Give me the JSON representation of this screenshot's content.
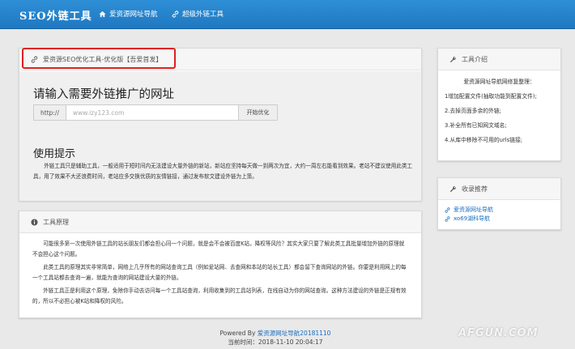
{
  "header": {
    "brand": "SEO外链工具",
    "nav": [
      {
        "label": "爱资源网址导航",
        "icon": "home-icon"
      },
      {
        "label": "超级外链工具",
        "icon": "link-icon"
      }
    ]
  },
  "main": {
    "panel_title": "爱资源SEO优化工具-优化版【吾爱首发】",
    "heading": "请输入需要外链推广的网址",
    "input_addon": "http://",
    "input_placeholder": "www.izy123.com",
    "submit_label": "开始优化",
    "tips_heading": "使用提示",
    "tips_text": "外链工具只是辅助工具，一般适用于短时间内无法建设大量外链的新站，新站应坚持每天做一到两次为宜，大约一周左右能看到效果。老站不建议使用此类工具，用了效果不大还浪费时间，老站应多交换优质的友情链接，通过发布软文建设外链为上策。"
  },
  "principle": {
    "title": "工具原理",
    "paragraphs": [
      "可能很多第一次使用外链工具的站长朋友们都会担心同一个问题，就是会不会被百度K站，降权等风险？其实大家只要了解此类工具批量增加外链的原理就不会担心这个问题。",
      "此类工具的原理其实非常简单，网络上几乎所有的网站查询工具（例如爱站网、去查网和本站的站长工具）都会留下查询网站的外链。你要是利用网上的每一个工具站都去查询一遍，就能为查询的网站建设大量的外链。",
      "外链工具正是利用这个原理，免除你手动去访问每一个工具站查询，利用收集到的工具站列表，在线自动为你的网站查询。这种方法建设的外链是正规有效的，所以不必担心被K站和降权的风险。"
    ]
  },
  "intro": {
    "title": "工具介绍",
    "heading": "爱资源网址导航网修复整理：",
    "items": [
      "1增加配置文件(抽取功能到配置文件);",
      "2.去掉页面多余的外链;",
      "3.补全所有已知网文域名;",
      "4.从库中移除不可用的urls链接;"
    ]
  },
  "favorites": {
    "title": "收录推荐",
    "links": [
      "爱资源网址导航",
      "xo69湖科导航"
    ]
  },
  "footer": {
    "powered_prefix": "Powered By ",
    "powered_link": "爱资源网址导航20181110",
    "time_line": "当前时间：2018-11-10 20:04:17"
  },
  "watermark": "AFGUN.COM"
}
